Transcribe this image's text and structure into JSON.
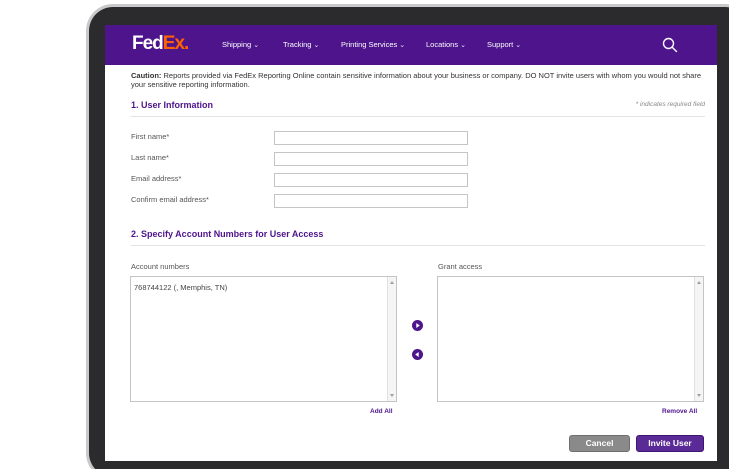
{
  "brand": {
    "fed": "Fed",
    "ex": "Ex",
    "dot": "."
  },
  "nav": {
    "items": [
      {
        "label": "Shipping"
      },
      {
        "label": "Tracking"
      },
      {
        "label": "Printing Services"
      },
      {
        "label": "Locations"
      },
      {
        "label": "Support"
      }
    ],
    "search_icon": "search-icon"
  },
  "caution": {
    "label": "Caution:",
    "text": " Reports provided via FedEx Reporting Online contain sensitive information about your business or company. DO NOT invite users with whom you would not share your sensitive reporting information."
  },
  "section1": {
    "title": "1. User Information",
    "required_note": "* indicates required field",
    "fields": [
      {
        "label": "First name*",
        "value": ""
      },
      {
        "label": "Last name*",
        "value": ""
      },
      {
        "label": "Email address*",
        "value": ""
      },
      {
        "label": "Confirm email address*",
        "value": ""
      }
    ]
  },
  "section2": {
    "title": "2. Specify Account Numbers for User Access",
    "account_numbers_label": "Account numbers",
    "account_options": [
      "768744122 (, Memphis, TN)"
    ],
    "grant_access_label": "Grant access",
    "grant_options": [],
    "add_all": "Add All",
    "remove_all": "Remove All"
  },
  "actions": {
    "cancel": "Cancel",
    "invite": "Invite User"
  },
  "colors": {
    "brand_purple": "#4d148c",
    "brand_orange": "#ff6200",
    "button_gray": "#8a8a8a"
  }
}
